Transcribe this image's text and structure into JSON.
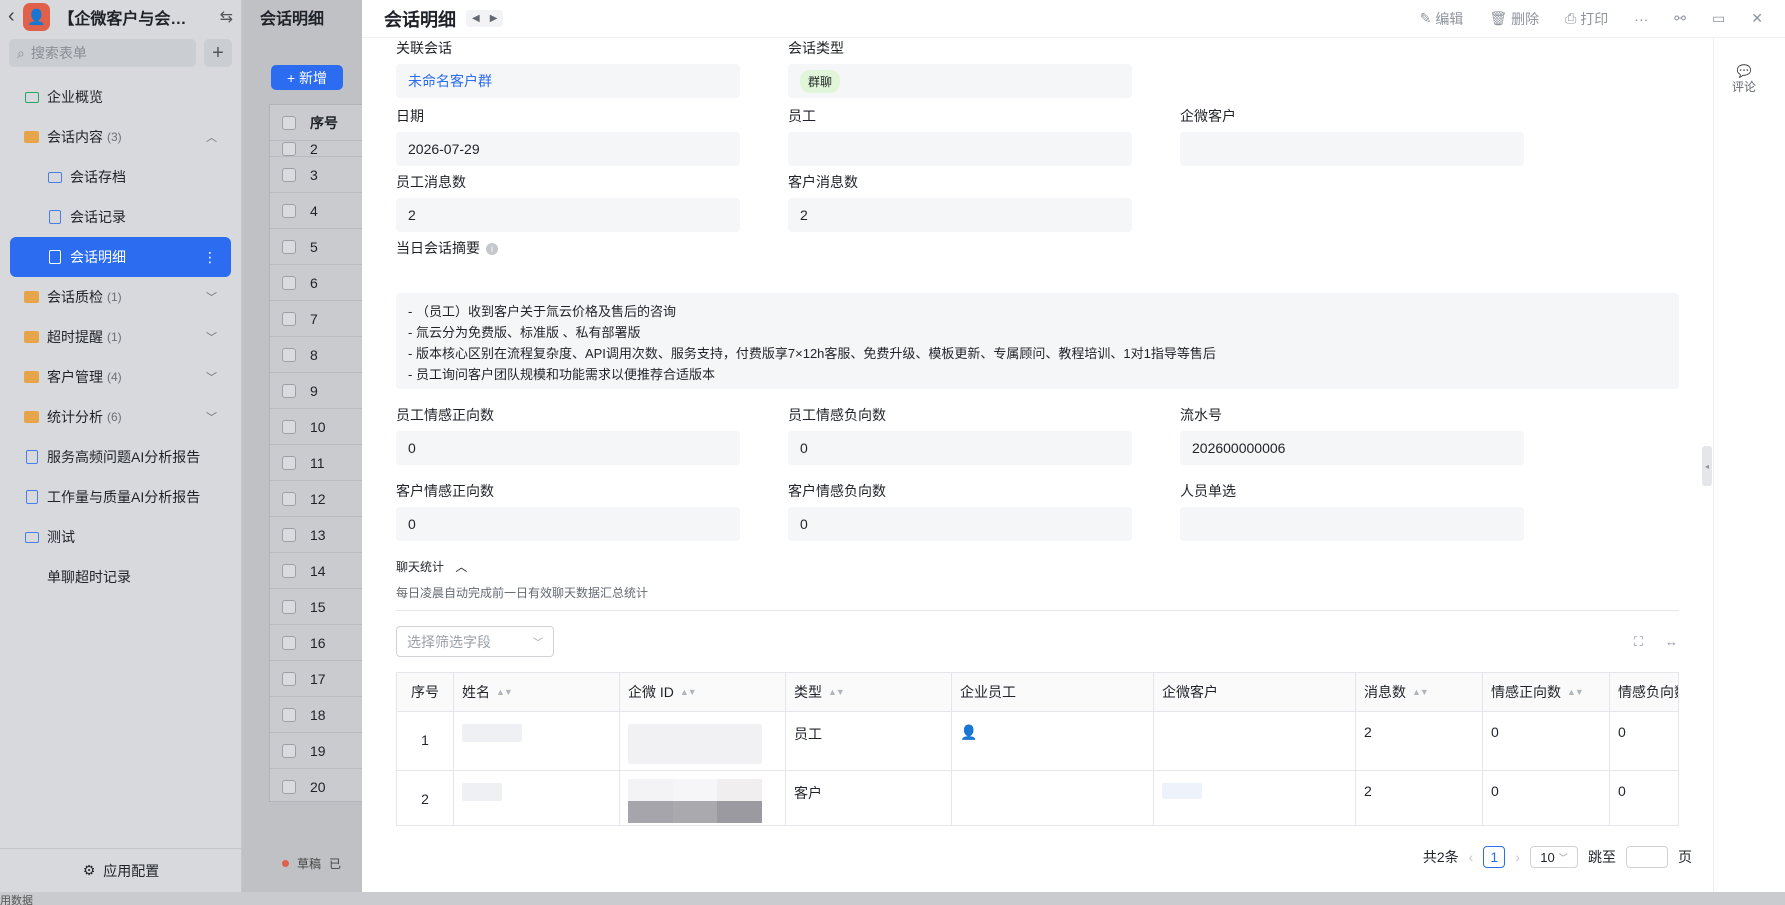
{
  "app": {
    "title": "【企微客户与会…",
    "back_icon": "chevron-left-icon",
    "switch_icon": "swap-icon"
  },
  "sidebar": {
    "search_placeholder": "搜索表单",
    "items": [
      {
        "label": "企业概览",
        "count": "",
        "icon": "dashboard-icon"
      },
      {
        "label": "会话内容",
        "count": "(3)",
        "icon": "folder-icon"
      },
      {
        "label": "会话存档",
        "count": "",
        "icon": "chat-archive-icon"
      },
      {
        "label": "会话记录",
        "count": "",
        "icon": "form-icon"
      },
      {
        "label": "会话明细",
        "count": "",
        "icon": "form-icon"
      },
      {
        "label": "会话质检",
        "count": "(1)",
        "icon": "folder-icon"
      },
      {
        "label": "超时提醒",
        "count": "(1)",
        "icon": "folder-icon"
      },
      {
        "label": "客户管理",
        "count": "(4)",
        "icon": "folder-icon"
      },
      {
        "label": "统计分析",
        "count": "(6)",
        "icon": "folder-icon"
      },
      {
        "label": "服务高频问题AI分析报告",
        "count": "",
        "icon": "report-icon"
      },
      {
        "label": "工作量与质量AI分析报告",
        "count": "",
        "icon": "report-icon"
      },
      {
        "label": "测试",
        "count": "",
        "icon": "dashboard-icon"
      },
      {
        "label": "单聊超时记录",
        "count": "",
        "icon": ""
      }
    ],
    "footer": "应用配置"
  },
  "background": {
    "header": "会话明细",
    "new_button": "+ 新增",
    "col_no": "序号",
    "rows": [
      "2",
      "3",
      "4",
      "5",
      "6",
      "7",
      "8",
      "9",
      "10",
      "11",
      "12",
      "13",
      "14",
      "15",
      "16",
      "17",
      "18",
      "19",
      "20"
    ],
    "status_draft": "草稿",
    "status_other": "已",
    "bottom_text": "用数据"
  },
  "drawer": {
    "title": "会话明细",
    "actions": {
      "edit": "编辑",
      "delete": "删除",
      "print": "打印",
      "more": "···"
    },
    "fields": {
      "related_session": {
        "label": "关联会话",
        "value": "未命名客户群"
      },
      "session_type": {
        "label": "会话类型",
        "value": "群聊"
      },
      "date": {
        "label": "日期",
        "value": "2026-07-29"
      },
      "employee": {
        "label": "员工",
        "value": ""
      },
      "wecom_customer": {
        "label": "企微客户",
        "value": ""
      },
      "employee_msg_count": {
        "label": "员工消息数",
        "value": "2"
      },
      "customer_msg_count": {
        "label": "客户消息数",
        "value": "2"
      },
      "summary_label": "当日会话摘要",
      "summary_lines": [
        "-             （员工）收到客户关于氚云价格及售后的咨询",
        "- 氚云分为免费版、标准版                                                                                                          、私有部署版",
        "- 版本核心区别在流程复杂度、API调用次数、服务支持，付费版享7×12h客服、免费升级、模板更新、专属顾问、教程培训、1对1指导等售后",
        "- 员工询问客户团队规模和功能需求以便推荐合适版本"
      ],
      "emp_pos": {
        "label": "员工情感正向数",
        "value": "0"
      },
      "emp_neg": {
        "label": "员工情感负向数",
        "value": "0"
      },
      "serial": {
        "label": "流水号",
        "value": "202600000006"
      },
      "cus_pos": {
        "label": "客户情感正向数",
        "value": "0"
      },
      "cus_neg": {
        "label": "客户情感负向数",
        "value": "0"
      },
      "person_single": {
        "label": "人员单选",
        "value": ""
      }
    },
    "chat_stats": {
      "title": "聊天统计",
      "desc": "每日凌晨自动完成前一日有效聊天数据汇总统计",
      "filter_placeholder": "选择筛选字段",
      "columns": [
        "序号",
        "姓名",
        "企微 ID",
        "类型",
        "企业员工",
        "企微客户",
        "消息数",
        "情感正向数",
        "情感负向数"
      ],
      "rows": [
        {
          "no": "1",
          "type": "员工",
          "msgs": "2",
          "pos": "0",
          "neg": "0"
        },
        {
          "no": "2",
          "type": "客户",
          "msgs": "2",
          "pos": "0",
          "neg": "0"
        }
      ],
      "pager": {
        "total": "共2条",
        "page": "1",
        "size": "10",
        "jump": "跳至",
        "page_unit": "页"
      }
    },
    "comment": "评论"
  }
}
